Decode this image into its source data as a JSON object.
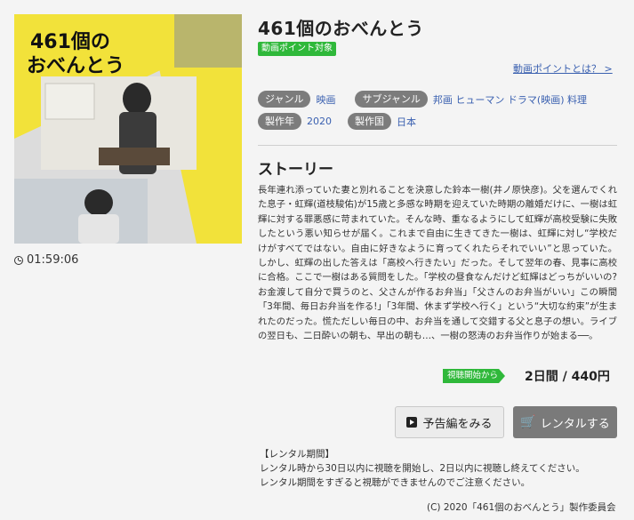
{
  "poster": {
    "title_line1": "461個の",
    "title_line2": "おべんとう"
  },
  "duration": "01:59:06",
  "title": "461個のおべんとう",
  "point_badge": "動画ポイント対象",
  "point_link": "動画ポイントとは？ >",
  "meta": {
    "genre_label": "ジャンル",
    "genre_value": "映画",
    "subgenre_label": "サブジャンル",
    "subgenre_values": "邦画 ヒューマン ドラマ(映画) 料理",
    "year_label": "製作年",
    "year_value": "2020",
    "country_label": "製作国",
    "country_value": "日本"
  },
  "story_heading": "ストーリー",
  "story_text": "長年連れ添っていた妻と別れることを決意した鈴本一樹(井ノ原快彦)。父を選んでくれた息子・虹輝(道枝駿佑)が15歳と多感な時期を迎えていた時期の離婚だけに、一樹は虹輝に対する罪悪感に苛まれていた。そんな時、重なるようにして虹輝が高校受験に失敗したという悪い知らせが届く。これまで自由に生きてきた一樹は、虹輝に対し“学校だけがすべてではない。自由に好きなように育ってくれたらそれでいい”と思っていた。しかし、虹輝の出した答えは「高校へ行きたい」だった。そして翌年の春、見事に高校に合格。ここで一樹はある質問をした。「学校の昼食なんだけど虹輝はどっちがいいの?お金渡して自分で買うのと、父さんが作るお弁当」「父さんのお弁当がいい」この瞬間「3年間、毎日お弁当を作る!」「3年間、休まず学校へ行く」という“大切な約束”が生まれたのだった。慌ただしい毎日の中、お弁当を通して交錯する父と息子の想い。ライブの翌日も、二日酔いの朝も、早出の朝も…、一樹の怒涛のお弁当作りが始まる──。",
  "price": {
    "tag": "視聴開始から",
    "value": "2日間 / 440円"
  },
  "buttons": {
    "trailer": "予告編をみる",
    "rent": "レンタルする"
  },
  "rental": {
    "heading": "【レンタル期間】",
    "line1": "レンタル時から30日以内に視聴を開始し、2日以内に視聴し終えてください。",
    "line2": "レンタル期間をすぎると視聴ができませんのでご注意ください。"
  },
  "copyright": "(C) 2020「461個のおべんとう」製作委員会",
  "colors": {
    "accent_green": "#2fb83a",
    "link_blue": "#3a60b0",
    "pill_gray": "#7c7c7c",
    "poster_yellow": "#f2e23a"
  }
}
